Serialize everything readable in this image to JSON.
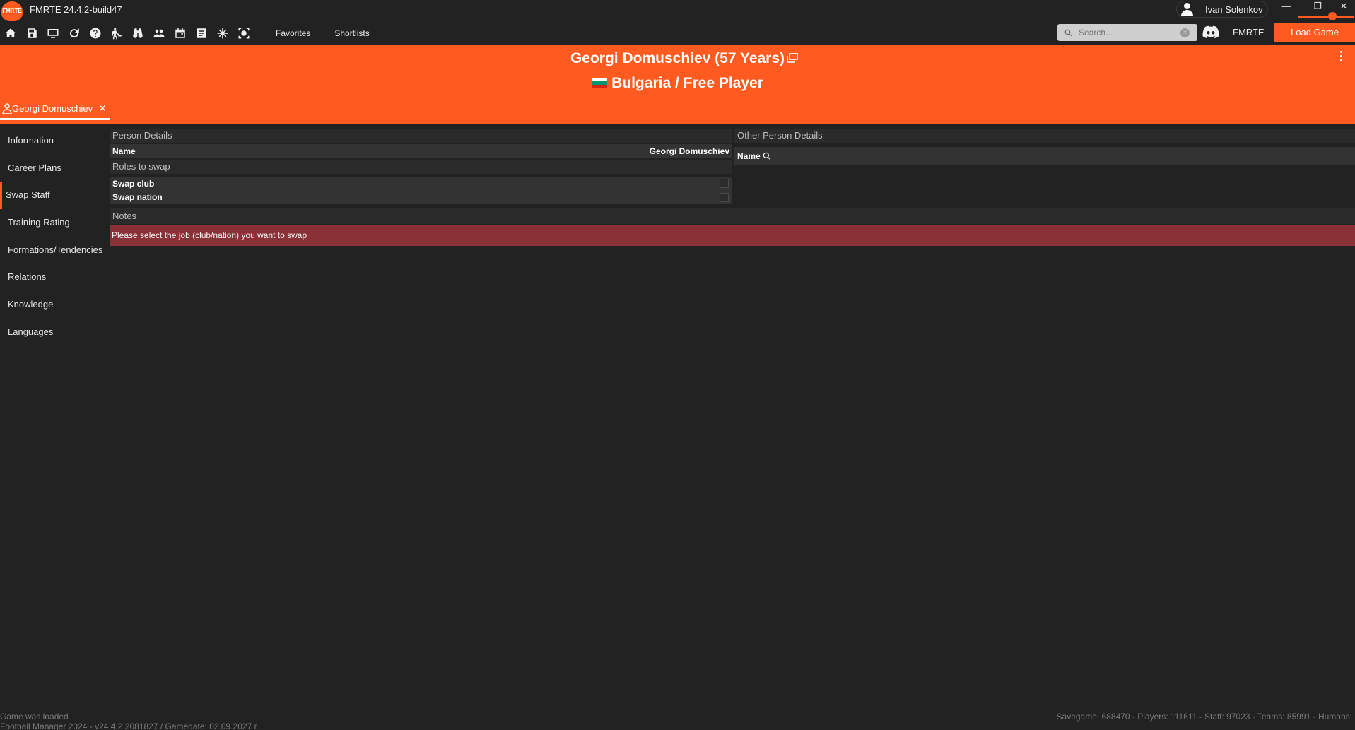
{
  "app": {
    "title": "FMRTE 24.4.2-build47",
    "logo_text": "FMRTE",
    "user_name": "Ivan Solenkov",
    "window_controls": {
      "minimize": "—",
      "restore": "❐",
      "close": "✕"
    }
  },
  "toolbar": {
    "icons": [
      "home-icon",
      "save-icon",
      "monitor-icon",
      "refresh-icon",
      "help-icon",
      "walking-person-icon",
      "binoculars-icon",
      "people-icon",
      "calendar-icon",
      "list-icon",
      "snowflake-icon",
      "screenshot-icon"
    ],
    "favorites": "Favorites",
    "shortlists": "Shortlists",
    "search_placeholder": "Search...",
    "clear": "×",
    "fmrte_link": "FMRTE",
    "load_game": "Load Game"
  },
  "header": {
    "title": "Georgi Domuschiev (57 Years)",
    "subtitle": "Bulgaria / Free Player",
    "tab_label": "Georgi Domuschiev",
    "tab_close": "✕",
    "flag_colors": [
      "#ffffff",
      "#00966e",
      "#d62612"
    ]
  },
  "sidebar": {
    "items": [
      {
        "label": "Information"
      },
      {
        "label": "Career Plans"
      },
      {
        "label": "Swap Staff"
      },
      {
        "label": "Training Rating"
      },
      {
        "label": "Formations/Tendencies"
      },
      {
        "label": "Relations"
      },
      {
        "label": "Knowledge"
      },
      {
        "label": "Languages"
      }
    ],
    "active": "Swap Staff"
  },
  "person_details": {
    "header": "Person Details",
    "name_label": "Name",
    "name_value": "Georgi Domuschiev"
  },
  "roles": {
    "header": "Roles to swap",
    "swap_club": "Swap club",
    "swap_nation": "Swap nation"
  },
  "other_person": {
    "header": "Other Person Details",
    "name_label": "Name"
  },
  "notes": {
    "header": "Notes",
    "message": "Please select the job (club/nation) you want to swap"
  },
  "status": {
    "line1": "Game was loaded",
    "line2": "Football Manager 2024 - v24.4.2 2081827 / Gamedate: 02.09.2027 г.",
    "right": "Savegame: 688470 - Players: 111611 - Staff: 97023 - Teams: 85991 - Humans:"
  },
  "colors": {
    "accent": "#ff5a1f",
    "background": "#222222",
    "alert": "#8a3037"
  }
}
